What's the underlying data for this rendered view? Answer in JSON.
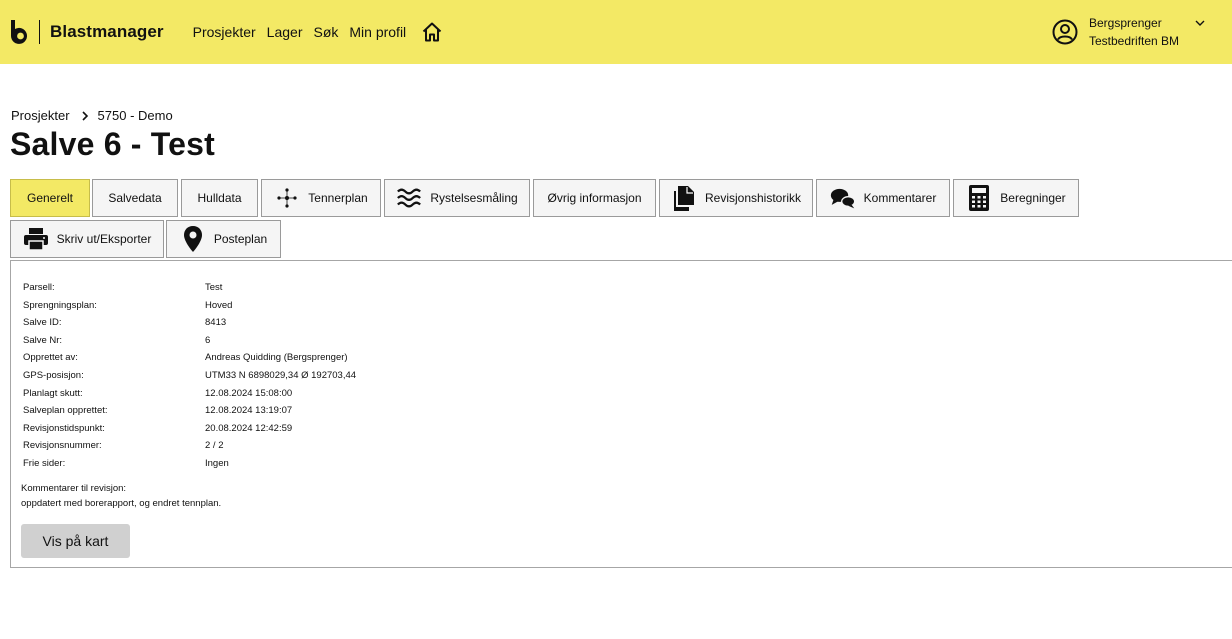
{
  "app": {
    "brand_name": "Blastmanager",
    "nav": [
      "Prosjekter",
      "Lager",
      "Søk",
      "Min profil"
    ],
    "user": {
      "role": "Bergsprenger",
      "company": "Testbedriften BM"
    },
    "colors": {
      "header": "#f3e965",
      "active_tab": "#f3e965",
      "button": "#d0d0d0"
    }
  },
  "breadcrumb": {
    "root": "Prosjekter",
    "project": "5750 - Demo"
  },
  "page": {
    "title": "Salve 6 - Test"
  },
  "tabs": {
    "generelt": "Generelt",
    "salvedata": "Salvedata",
    "hulldata": "Hulldata",
    "tennerplan": "Tennerplan",
    "rystelse": "Rystelsesmåling",
    "ovrig": "Øvrig informasjon",
    "revisjon": "Revisjonshistorikk",
    "kommentarer": "Kommentarer",
    "beregninger": "Beregninger",
    "skriv_ut": "Skriv ut/Eksporter",
    "posteplan": "Posteplan"
  },
  "info": [
    {
      "label": "Parsell:",
      "value": "Test"
    },
    {
      "label": "Sprengningsplan:",
      "value": "Hoved"
    },
    {
      "label": "Salve ID:",
      "value": "8413"
    },
    {
      "label": "Salve Nr:",
      "value": "6"
    },
    {
      "label": "Opprettet av:",
      "value": "Andreas Quidding (Bergsprenger)"
    },
    {
      "label": "GPS-posisjon:",
      "value": "UTM33 N 6898029,34 Ø 192703,44"
    },
    {
      "label": "Planlagt skutt:",
      "value": "12.08.2024 15:08:00"
    },
    {
      "label": "Salveplan opprettet:",
      "value": "12.08.2024 13:19:07"
    },
    {
      "label": "Revisjonstidspunkt:",
      "value": "20.08.2024 12:42:59"
    },
    {
      "label": "Revisjonsnummer:",
      "value": "2 / 2"
    },
    {
      "label": "Frie sider:",
      "value": "Ingen"
    }
  ],
  "comment": {
    "label": "Kommentarer til revisjon:",
    "text": "oppdatert med borerapport, og endret tennplan."
  },
  "map_button": "Vis på kart"
}
